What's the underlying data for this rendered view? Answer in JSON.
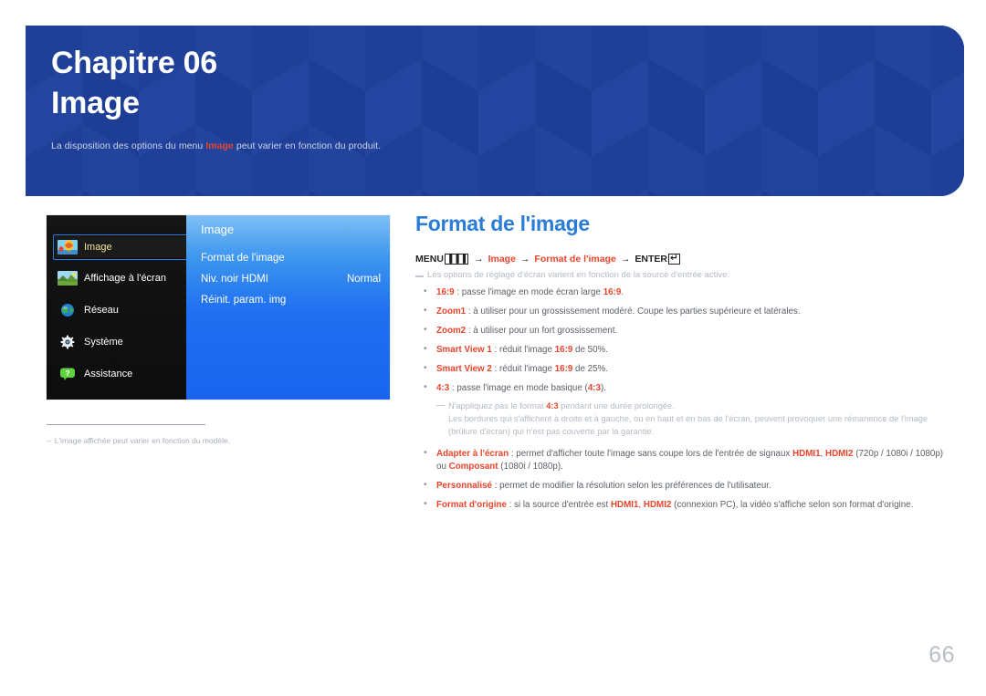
{
  "banner": {
    "chapter_label": "Chapitre 06",
    "chapter_title": "Image",
    "note_prefix": "La disposition des options du menu ",
    "note_highlight": "Image",
    "note_suffix": " peut varier en fonction du produit.",
    "bg_color": "#20409a",
    "highlight_color": "#e8452b"
  },
  "osd": {
    "sidebar": [
      {
        "label": "Image",
        "icon": "balloon-icon",
        "selected": true
      },
      {
        "label": "Affichage à l'écran",
        "icon": "landscape-icon",
        "selected": false
      },
      {
        "label": "Réseau",
        "icon": "globe-icon",
        "selected": false
      },
      {
        "label": "Système",
        "icon": "gear-icon",
        "selected": false
      },
      {
        "label": "Assistance",
        "icon": "help-bubble-icon",
        "selected": false
      }
    ],
    "panel_title": "Image",
    "rows": [
      {
        "label": "Format de l'image",
        "value": ""
      },
      {
        "label": "Niv. noir HDMI",
        "value": "Normal"
      },
      {
        "label": "Réinit. param. img",
        "value": ""
      }
    ],
    "footnote": "L'image affichée peut varier en fonction du modèle.",
    "footnote_dash": "–"
  },
  "content": {
    "heading": "Format de l'image",
    "menu_path": {
      "menu": "MENU",
      "menu_glyph": "▐▐▐",
      "step1": "Image",
      "step2": "Format de l'image",
      "enter": "ENTER",
      "enter_glyph": "↵",
      "arrow": "→"
    },
    "intro_note": "Les options de réglage d'écran varient en fonction de la source d'entrée active.",
    "bullets": [
      {
        "term": "16:9",
        "rest_pre": " : passe l'image en mode écran large ",
        "rest_hl": "16:9",
        "rest_post": "."
      },
      {
        "term": "Zoom1",
        "rest_pre": " : à utiliser pour un grossissement modéré. Coupe les parties supérieure et latérales.",
        "rest_hl": "",
        "rest_post": ""
      },
      {
        "term": "Zoom2",
        "rest_pre": " : à utiliser pour un fort grossissement.",
        "rest_hl": "",
        "rest_post": ""
      },
      {
        "term": "Smart View 1",
        "rest_pre": " : réduit l'image ",
        "rest_hl": "16:9",
        "rest_post": " de 50%."
      },
      {
        "term": "Smart View 2",
        "rest_pre": " : réduit l'image ",
        "rest_hl": "16:9",
        "rest_post": " de 25%."
      },
      {
        "term": "4:3",
        "rest_pre": " : passe l'image en mode basique (",
        "rest_hl": "4:3",
        "rest_post": ")."
      }
    ],
    "subnote": {
      "line1_pre": "N'appliquez pas le format ",
      "line1_hl": "4:3",
      "line1_post": " pendant une durée prolongée.",
      "line2": "Les bordures qui s'affichent à droite et à gauche, ou en haut et en bas de l'écran, peuvent provoquer une rémanence de l'image (brûlure d'écran) qui n'est pas couverte par la garantie."
    },
    "bullets2": [
      {
        "term": "Adapter à l'écran",
        "p1": " : permet d'afficher toute l'image sans coupe lors de l'entrée de signaux ",
        "hl1": "HDMI1",
        "p2": ", ",
        "hl2": "HDMI2",
        "p3": " (720p / 1080i / 1080p) ou ",
        "hl3": "Composant",
        "p4": " (1080i / 1080p)."
      },
      {
        "term": "Personnalisé",
        "p1": " : permet de modifier la résolution selon les préférences de l'utilisateur.",
        "hl1": "",
        "p2": "",
        "hl2": "",
        "p3": "",
        "hl3": "",
        "p4": ""
      },
      {
        "term": "Format d'origine",
        "p1": " : si la source d'entrée est ",
        "hl1": "HDMI1",
        "p2": ", ",
        "hl2": "HDMI2",
        "p3": " (connexion PC), la vidéo s'affiche selon son format d'origine.",
        "hl3": "",
        "p4": ""
      }
    ]
  },
  "page_number": "66"
}
